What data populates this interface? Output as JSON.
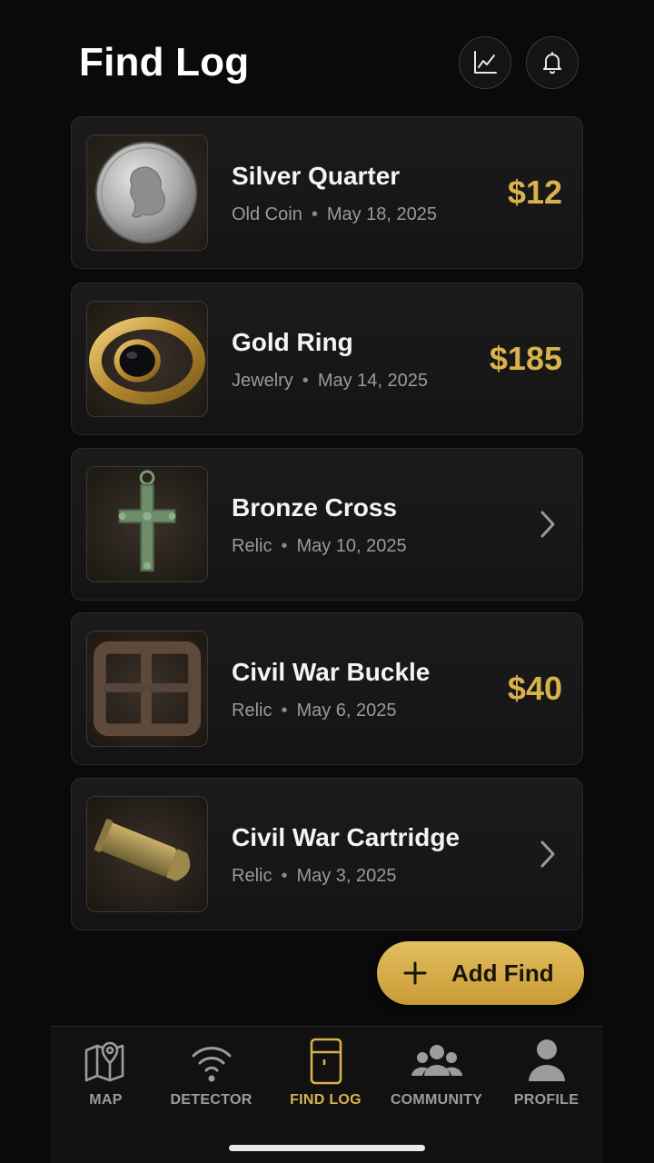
{
  "header": {
    "title": "Find Log",
    "actions": [
      {
        "icon": "trend-chart-icon"
      },
      {
        "icon": "bell-icon"
      }
    ]
  },
  "finds": [
    {
      "name": "Silver Quarter",
      "category": "Old Coin",
      "date": "May 18, 2025",
      "value": "$12",
      "thumbnail": "silver-quarter-1964-photo"
    },
    {
      "name": "Gold Ring",
      "category": "Jewelry",
      "date": "May 14, 2025",
      "value": "$185",
      "thumbnail": "gold-ring-black-stone-photo"
    },
    {
      "name": "Bronze Cross",
      "category": "Relic",
      "date": "May 10, 2025",
      "value": "",
      "thumbnail": "bronze-cross-photo"
    },
    {
      "name": "Civil War Buckle",
      "category": "Relic",
      "date": "May 6, 2025",
      "value": "$40",
      "thumbnail": "rusty-buckle-photo"
    },
    {
      "name": "Civil War Cartridge",
      "category": "Relic",
      "date": "May 3, 2025",
      "value": "",
      "thumbnail": "brass-cartridge-photo"
    }
  ],
  "add_button": {
    "label": "Add Find",
    "icon": "plus-icon"
  },
  "tabs": [
    {
      "label": "MAP",
      "icon": "map-pin-icon",
      "active": false
    },
    {
      "label": "DETECTOR",
      "icon": "signal-icon",
      "active": false
    },
    {
      "label": "FIND LOG",
      "icon": "log-book-icon",
      "active": true
    },
    {
      "label": "COMMUNITY",
      "icon": "group-icon",
      "active": false
    },
    {
      "label": "PROFILE",
      "icon": "person-icon",
      "active": false
    }
  ],
  "colors": {
    "background": "#0a0a0a",
    "card": "#161616",
    "accent_gold": "#d9b24c",
    "text_secondary": "#9a9a9a"
  }
}
